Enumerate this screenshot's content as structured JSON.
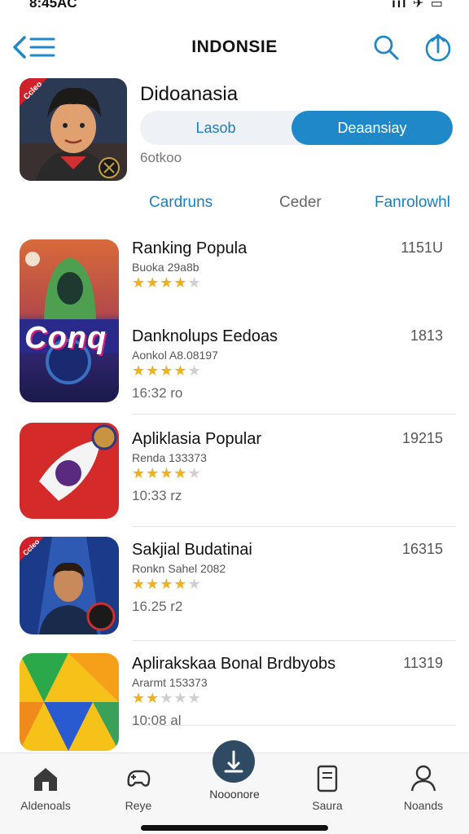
{
  "status": {
    "time": "8:45AC",
    "right": "ııl ✈ ▭"
  },
  "header": {
    "title": "INDONSIE"
  },
  "hero": {
    "title": "Didoanasia",
    "segment_left": "Lasob",
    "segment_right": "Deaansiay",
    "subtitle": "6otkoo",
    "badge": "Ccleo"
  },
  "tabs": [
    "Cardruns",
    "Ceder",
    "Fanrolowhl"
  ],
  "apps": [
    {
      "title": "Ranking Popula",
      "sub": "Buoka 29a8b",
      "count": "1151U",
      "rating": 4,
      "icon_text": "Conq"
    },
    {
      "title": "Danknolups Eedoas",
      "sub": "Aonkol A8.08197",
      "count": "1813",
      "rating": 4,
      "time": "16:32 ro"
    },
    {
      "title": "Apliklasia Popular",
      "sub": "Renda 133373",
      "count": "19215",
      "rating": 4,
      "time": "10:33 rz"
    },
    {
      "title": "Sakjial Budatinai",
      "sub": "Ronkn Sahel 2082",
      "count": "16315",
      "rating": 4,
      "time": "16.25 r2",
      "badge": "Ccleo"
    },
    {
      "title": "Aplirakskaa Bonal Brdbyobs",
      "sub": "Ararmt 153373",
      "count": "11319",
      "rating": 2,
      "time": "10:08 al"
    }
  ],
  "nav": {
    "item1": "Aldenoals",
    "item2": "Reye",
    "center": "Nooonore",
    "item4": "Saura",
    "item5": "Noands"
  },
  "colors": {
    "accent": "#1e88c8",
    "star": "#f2b01e",
    "fab": "#2f4b63"
  }
}
